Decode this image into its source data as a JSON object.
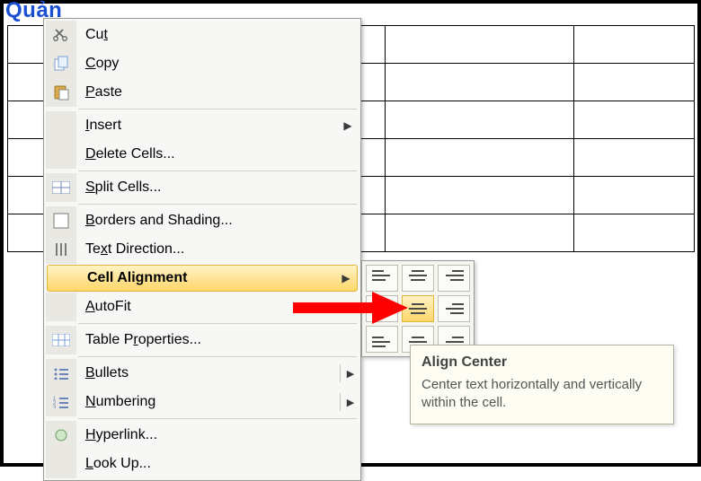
{
  "doc_heading": "Quản",
  "menu": {
    "cut": "Cut",
    "copy": "Copy",
    "paste": "Paste",
    "insert": "Insert",
    "delete_cells": "Delete Cells...",
    "split_cells": "Split Cells...",
    "borders_shading": "Borders and Shading...",
    "text_direction": "Text Direction...",
    "cell_alignment": "Cell Alignment",
    "autofit": "AutoFit",
    "table_properties": "Table Properties...",
    "bullets": "Bullets",
    "numbering": "Numbering",
    "hyperlink": "Hyperlink...",
    "look_up": "Look Up..."
  },
  "tooltip": {
    "title": "Align Center",
    "body": "Center text horizontally and vertically within the cell."
  },
  "alignment_options": [
    "align-top-left",
    "align-top-center",
    "align-top-right",
    "align-center-left",
    "align-center",
    "align-center-right",
    "align-bottom-left",
    "align-bottom-center",
    "align-bottom-right"
  ]
}
